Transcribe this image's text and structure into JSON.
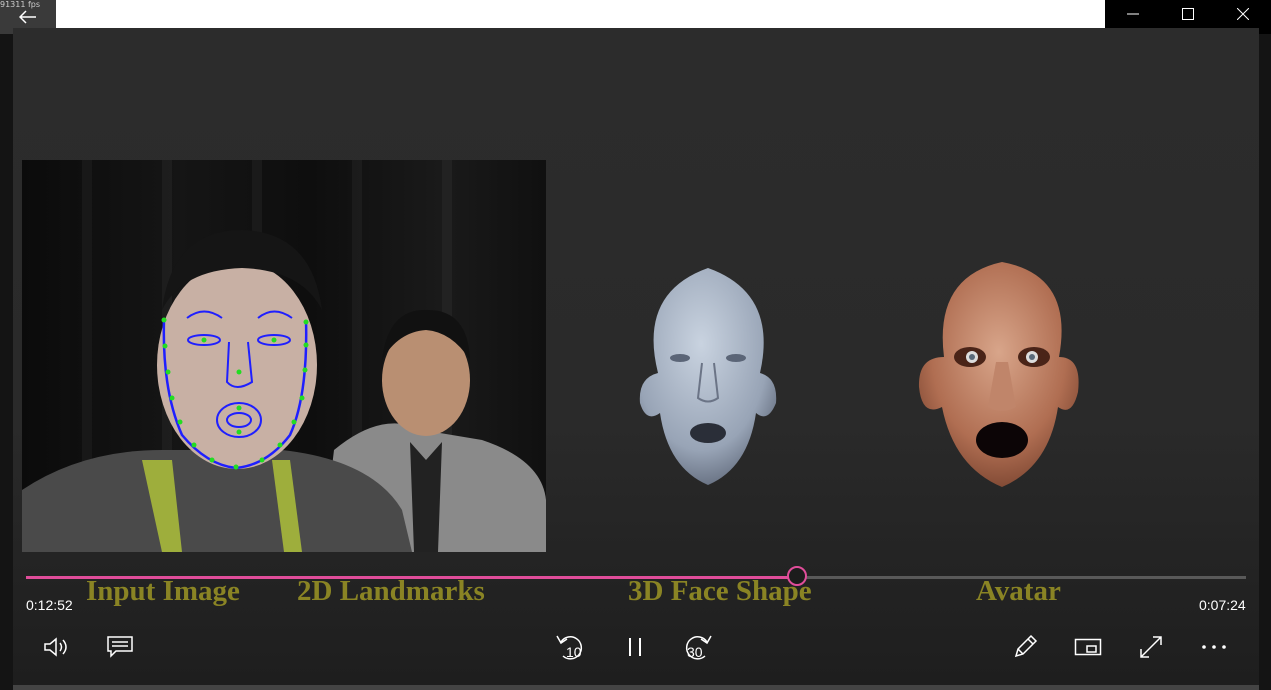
{
  "window": {
    "fps_text": "91311 fps",
    "back_icon": "back-arrow-icon",
    "controls": [
      "minimize-icon",
      "maximize-icon",
      "close-icon"
    ]
  },
  "video": {
    "captions": {
      "input_image": "Input Image",
      "landmarks": "2D Landmarks",
      "face_shape": "3D Face Shape",
      "avatar": "Avatar"
    }
  },
  "player": {
    "elapsed": "0:12:52",
    "remaining": "0:07:24",
    "progress": 0.632,
    "accent_color": "#e04d9a",
    "skip_back_label": "10",
    "skip_forward_label": "30",
    "buttons": {
      "volume": "volume-icon",
      "captions": "subtitles-icon",
      "skip_back": "skip-back-10-icon",
      "play_pause": "pause-icon",
      "skip_forward": "skip-forward-30-icon",
      "edit": "pen-icon",
      "mini_view": "mini-view-icon",
      "fullscreen": "fullscreen-icon",
      "more": "more-options-icon"
    }
  }
}
